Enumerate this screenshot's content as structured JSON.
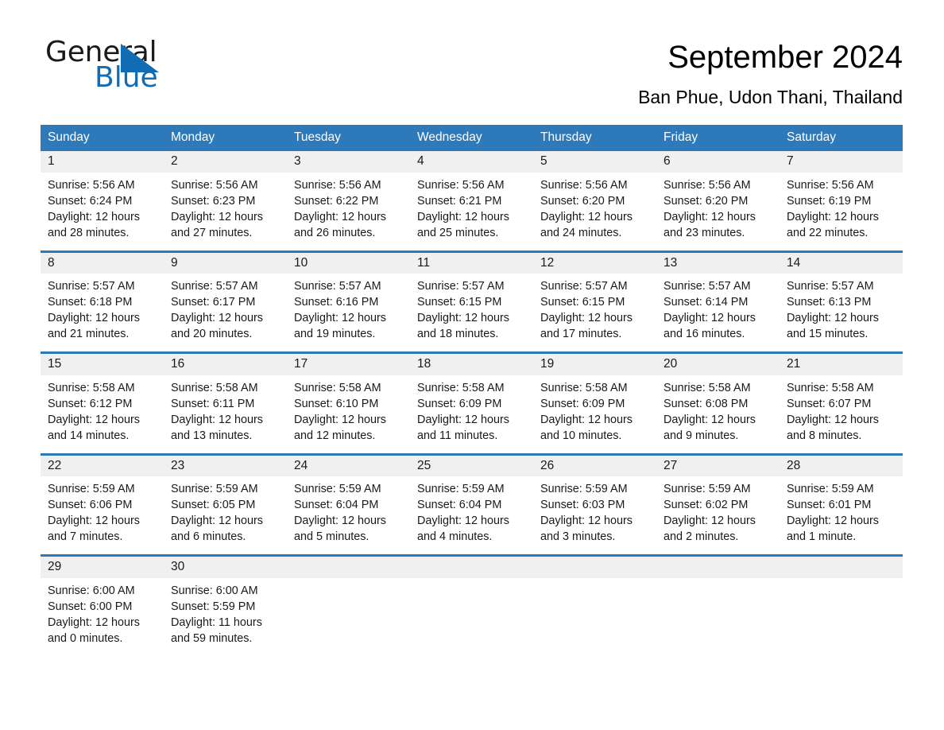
{
  "brand": {
    "name_part1": "General",
    "name_part2": "Blue",
    "triangle_color": "#0f6cb5"
  },
  "header": {
    "title": "September 2024",
    "subtitle": "Ban Phue, Udon Thani, Thailand"
  },
  "colors": {
    "header_blue": "#2e79b9",
    "daynum_band": "#f0f0f0",
    "text": "#1a1a1a"
  },
  "calendar": {
    "weekday_headers": [
      "Sunday",
      "Monday",
      "Tuesday",
      "Wednesday",
      "Thursday",
      "Friday",
      "Saturday"
    ],
    "weeks": [
      [
        {
          "day": "1",
          "sunrise": "Sunrise: 5:56 AM",
          "sunset": "Sunset: 6:24 PM",
          "daylight_1": "Daylight: 12 hours",
          "daylight_2": "and 28 minutes."
        },
        {
          "day": "2",
          "sunrise": "Sunrise: 5:56 AM",
          "sunset": "Sunset: 6:23 PM",
          "daylight_1": "Daylight: 12 hours",
          "daylight_2": "and 27 minutes."
        },
        {
          "day": "3",
          "sunrise": "Sunrise: 5:56 AM",
          "sunset": "Sunset: 6:22 PM",
          "daylight_1": "Daylight: 12 hours",
          "daylight_2": "and 26 minutes."
        },
        {
          "day": "4",
          "sunrise": "Sunrise: 5:56 AM",
          "sunset": "Sunset: 6:21 PM",
          "daylight_1": "Daylight: 12 hours",
          "daylight_2": "and 25 minutes."
        },
        {
          "day": "5",
          "sunrise": "Sunrise: 5:56 AM",
          "sunset": "Sunset: 6:20 PM",
          "daylight_1": "Daylight: 12 hours",
          "daylight_2": "and 24 minutes."
        },
        {
          "day": "6",
          "sunrise": "Sunrise: 5:56 AM",
          "sunset": "Sunset: 6:20 PM",
          "daylight_1": "Daylight: 12 hours",
          "daylight_2": "and 23 minutes."
        },
        {
          "day": "7",
          "sunrise": "Sunrise: 5:56 AM",
          "sunset": "Sunset: 6:19 PM",
          "daylight_1": "Daylight: 12 hours",
          "daylight_2": "and 22 minutes."
        }
      ],
      [
        {
          "day": "8",
          "sunrise": "Sunrise: 5:57 AM",
          "sunset": "Sunset: 6:18 PM",
          "daylight_1": "Daylight: 12 hours",
          "daylight_2": "and 21 minutes."
        },
        {
          "day": "9",
          "sunrise": "Sunrise: 5:57 AM",
          "sunset": "Sunset: 6:17 PM",
          "daylight_1": "Daylight: 12 hours",
          "daylight_2": "and 20 minutes."
        },
        {
          "day": "10",
          "sunrise": "Sunrise: 5:57 AM",
          "sunset": "Sunset: 6:16 PM",
          "daylight_1": "Daylight: 12 hours",
          "daylight_2": "and 19 minutes."
        },
        {
          "day": "11",
          "sunrise": "Sunrise: 5:57 AM",
          "sunset": "Sunset: 6:15 PM",
          "daylight_1": "Daylight: 12 hours",
          "daylight_2": "and 18 minutes."
        },
        {
          "day": "12",
          "sunrise": "Sunrise: 5:57 AM",
          "sunset": "Sunset: 6:15 PM",
          "daylight_1": "Daylight: 12 hours",
          "daylight_2": "and 17 minutes."
        },
        {
          "day": "13",
          "sunrise": "Sunrise: 5:57 AM",
          "sunset": "Sunset: 6:14 PM",
          "daylight_1": "Daylight: 12 hours",
          "daylight_2": "and 16 minutes."
        },
        {
          "day": "14",
          "sunrise": "Sunrise: 5:57 AM",
          "sunset": "Sunset: 6:13 PM",
          "daylight_1": "Daylight: 12 hours",
          "daylight_2": "and 15 minutes."
        }
      ],
      [
        {
          "day": "15",
          "sunrise": "Sunrise: 5:58 AM",
          "sunset": "Sunset: 6:12 PM",
          "daylight_1": "Daylight: 12 hours",
          "daylight_2": "and 14 minutes."
        },
        {
          "day": "16",
          "sunrise": "Sunrise: 5:58 AM",
          "sunset": "Sunset: 6:11 PM",
          "daylight_1": "Daylight: 12 hours",
          "daylight_2": "and 13 minutes."
        },
        {
          "day": "17",
          "sunrise": "Sunrise: 5:58 AM",
          "sunset": "Sunset: 6:10 PM",
          "daylight_1": "Daylight: 12 hours",
          "daylight_2": "and 12 minutes."
        },
        {
          "day": "18",
          "sunrise": "Sunrise: 5:58 AM",
          "sunset": "Sunset: 6:09 PM",
          "daylight_1": "Daylight: 12 hours",
          "daylight_2": "and 11 minutes."
        },
        {
          "day": "19",
          "sunrise": "Sunrise: 5:58 AM",
          "sunset": "Sunset: 6:09 PM",
          "daylight_1": "Daylight: 12 hours",
          "daylight_2": "and 10 minutes."
        },
        {
          "day": "20",
          "sunrise": "Sunrise: 5:58 AM",
          "sunset": "Sunset: 6:08 PM",
          "daylight_1": "Daylight: 12 hours",
          "daylight_2": "and 9 minutes."
        },
        {
          "day": "21",
          "sunrise": "Sunrise: 5:58 AM",
          "sunset": "Sunset: 6:07 PM",
          "daylight_1": "Daylight: 12 hours",
          "daylight_2": "and 8 minutes."
        }
      ],
      [
        {
          "day": "22",
          "sunrise": "Sunrise: 5:59 AM",
          "sunset": "Sunset: 6:06 PM",
          "daylight_1": "Daylight: 12 hours",
          "daylight_2": "and 7 minutes."
        },
        {
          "day": "23",
          "sunrise": "Sunrise: 5:59 AM",
          "sunset": "Sunset: 6:05 PM",
          "daylight_1": "Daylight: 12 hours",
          "daylight_2": "and 6 minutes."
        },
        {
          "day": "24",
          "sunrise": "Sunrise: 5:59 AM",
          "sunset": "Sunset: 6:04 PM",
          "daylight_1": "Daylight: 12 hours",
          "daylight_2": "and 5 minutes."
        },
        {
          "day": "25",
          "sunrise": "Sunrise: 5:59 AM",
          "sunset": "Sunset: 6:04 PM",
          "daylight_1": "Daylight: 12 hours",
          "daylight_2": "and 4 minutes."
        },
        {
          "day": "26",
          "sunrise": "Sunrise: 5:59 AM",
          "sunset": "Sunset: 6:03 PM",
          "daylight_1": "Daylight: 12 hours",
          "daylight_2": "and 3 minutes."
        },
        {
          "day": "27",
          "sunrise": "Sunrise: 5:59 AM",
          "sunset": "Sunset: 6:02 PM",
          "daylight_1": "Daylight: 12 hours",
          "daylight_2": "and 2 minutes."
        },
        {
          "day": "28",
          "sunrise": "Sunrise: 5:59 AM",
          "sunset": "Sunset: 6:01 PM",
          "daylight_1": "Daylight: 12 hours",
          "daylight_2": "and 1 minute."
        }
      ],
      [
        {
          "day": "29",
          "sunrise": "Sunrise: 6:00 AM",
          "sunset": "Sunset: 6:00 PM",
          "daylight_1": "Daylight: 12 hours",
          "daylight_2": "and 0 minutes."
        },
        {
          "day": "30",
          "sunrise": "Sunrise: 6:00 AM",
          "sunset": "Sunset: 5:59 PM",
          "daylight_1": "Daylight: 11 hours",
          "daylight_2": "and 59 minutes."
        },
        {
          "day": "",
          "sunrise": "",
          "sunset": "",
          "daylight_1": "",
          "daylight_2": ""
        },
        {
          "day": "",
          "sunrise": "",
          "sunset": "",
          "daylight_1": "",
          "daylight_2": ""
        },
        {
          "day": "",
          "sunrise": "",
          "sunset": "",
          "daylight_1": "",
          "daylight_2": ""
        },
        {
          "day": "",
          "sunrise": "",
          "sunset": "",
          "daylight_1": "",
          "daylight_2": ""
        },
        {
          "day": "",
          "sunrise": "",
          "sunset": "",
          "daylight_1": "",
          "daylight_2": ""
        }
      ]
    ]
  }
}
